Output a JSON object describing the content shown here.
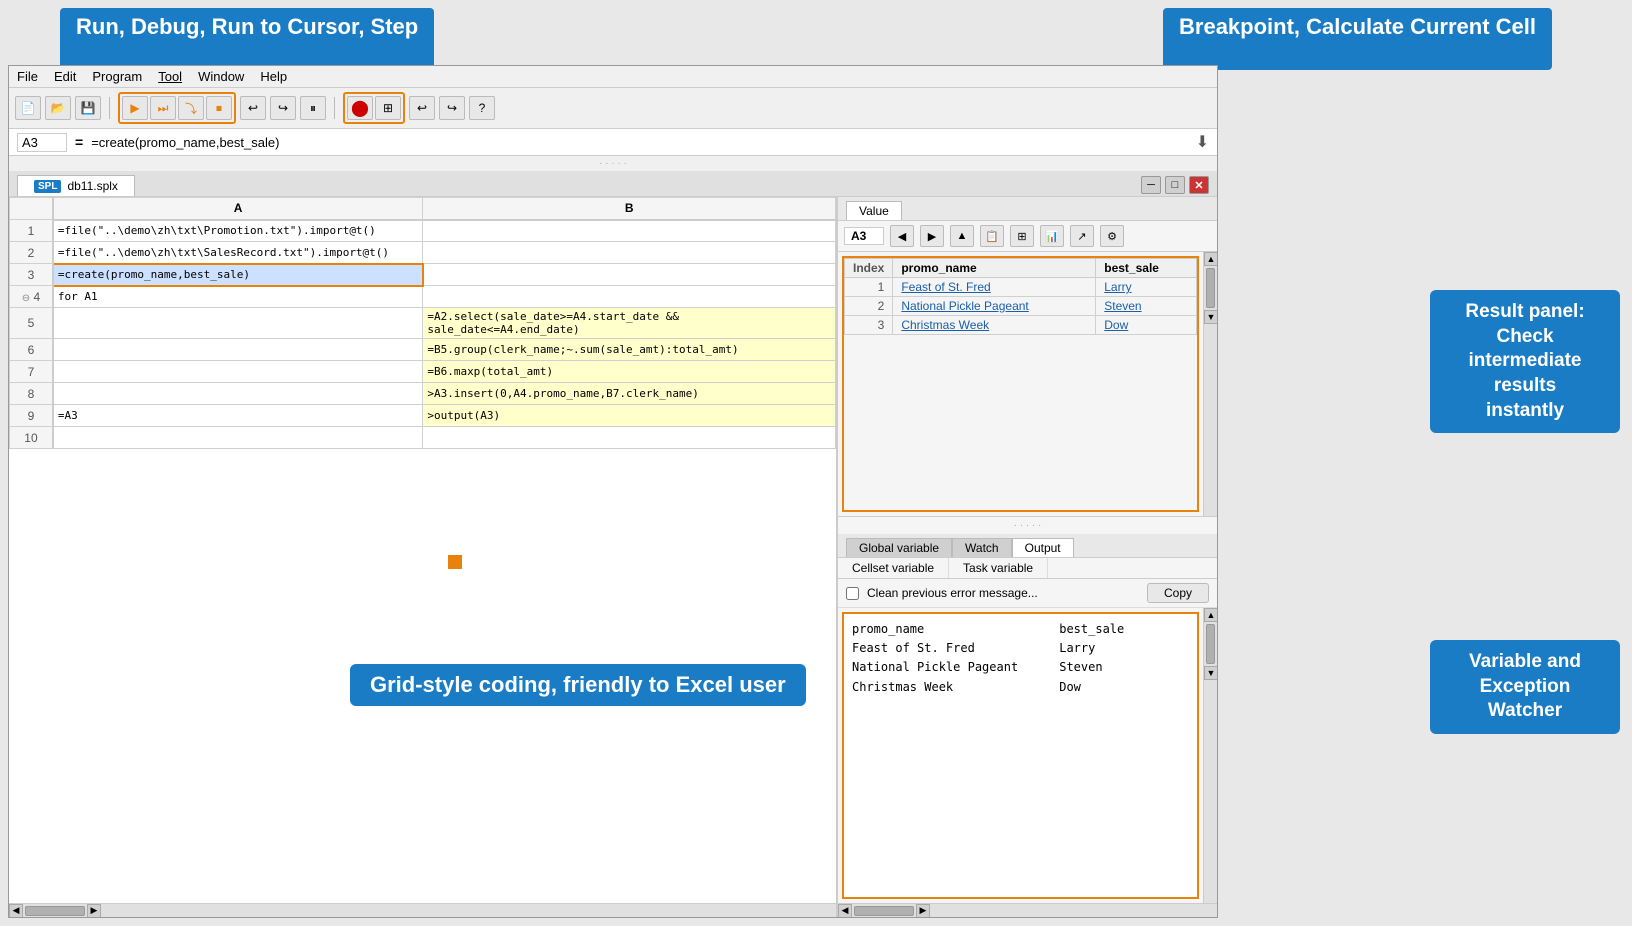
{
  "annotations": {
    "top_left": "Run, Debug, Run to Cursor, Step",
    "top_right": "Breakpoint, Calculate Current Cell",
    "right_middle": "Result panel:\nCheck\nintermediate\nresults\ninstantly",
    "right_bottom": "Variable and\nException\nWatcher",
    "bottom_center": "Grid-style coding, friendly to Excel user"
  },
  "menu": {
    "items": [
      "File",
      "Edit",
      "Program",
      "Tool",
      "Window",
      "Help"
    ]
  },
  "formula_bar": {
    "cell_ref": "A3",
    "eq": "=",
    "formula": "=create(promo_name,best_sale)"
  },
  "file_tab": {
    "name": "db11.splx",
    "badge": "SPL"
  },
  "grid": {
    "col_headers": [
      "",
      "A",
      "B"
    ],
    "rows": [
      {
        "row": "1",
        "a": "=file(\"..\\demo\\zh\\txt\\Promotion.txt\").import@t()",
        "b": "",
        "highlight_a": false,
        "highlight_b": false
      },
      {
        "row": "2",
        "a": "=file(\"..\\demo\\zh\\txt\\SalesRecord.txt\").import@t()",
        "b": "",
        "highlight_a": false,
        "highlight_b": false
      },
      {
        "row": "3",
        "a": "=create(promo_name,best_sale)",
        "b": "",
        "highlight_a": true,
        "highlight_b": false,
        "selected_a": true
      },
      {
        "row": "4",
        "a": "for A1",
        "b": "",
        "highlight_a": false,
        "highlight_b": false,
        "group": true
      },
      {
        "row": "5",
        "a": "",
        "b": "=A2.select(sale_date>=A4.start_date &&\nsale_date<=A4.end_date)",
        "highlight_a": false,
        "highlight_b": true
      },
      {
        "row": "6",
        "a": "",
        "b": "=B5.group(clerk_name;~.sum(sale_amt):total_amt)",
        "highlight_a": false,
        "highlight_b": true
      },
      {
        "row": "7",
        "a": "",
        "b": "=B6.maxp(total_amt)",
        "highlight_a": false,
        "highlight_b": true
      },
      {
        "row": "8",
        "a": "",
        "b": ">A3.insert(0,A4.promo_name,B7.clerk_name)",
        "highlight_a": false,
        "highlight_b": true
      },
      {
        "row": "9",
        "a": "=A3",
        "b": ">output(A3)",
        "highlight_a": false,
        "highlight_b": true
      },
      {
        "row": "10",
        "a": "",
        "b": "",
        "highlight_a": false,
        "highlight_b": false
      }
    ]
  },
  "value_panel": {
    "tab": "Value",
    "cell_ref": "A3",
    "result_table": {
      "headers": [
        "Index",
        "promo_name",
        "best_sale"
      ],
      "rows": [
        {
          "index": "1",
          "promo_name": "Feast of St. Fred",
          "best_sale": "Larry"
        },
        {
          "index": "2",
          "promo_name": "National Pickle Pageant",
          "best_sale": "Steven"
        },
        {
          "index": "3",
          "promo_name": "Christmas Week",
          "best_sale": "Dow"
        }
      ]
    }
  },
  "bottom_panel": {
    "tabs": [
      "Global variable",
      "Watch",
      "Output"
    ],
    "active_tab": "Output",
    "subtabs": [
      "Cellset variable",
      "Task variable"
    ],
    "checkbox_label": "Clean previous error message...",
    "copy_button": "Copy",
    "output_lines": [
      {
        "col1": "promo_name",
        "col2": "best_sale"
      },
      {
        "col1": "Feast of St. Fred",
        "col2": "Larry"
      },
      {
        "col1": "National Pickle Pageant",
        "col2": "Steven"
      },
      {
        "col1": "Christmas Week",
        "col2": "Dow"
      }
    ]
  },
  "toolbar": {
    "buttons": [
      {
        "name": "new",
        "icon": "📄"
      },
      {
        "name": "open",
        "icon": "📂"
      },
      {
        "name": "save",
        "icon": "💾"
      }
    ],
    "debug_group": [
      {
        "name": "run",
        "icon": "▶"
      },
      {
        "name": "debug-step-over",
        "icon": "⏭"
      },
      {
        "name": "step-into",
        "icon": "⤵"
      },
      {
        "name": "stop",
        "icon": "⏹"
      }
    ],
    "breakpoint_group": [
      {
        "name": "breakpoint",
        "icon": "⬤"
      },
      {
        "name": "calculate-cell",
        "icon": "⊞"
      }
    ]
  }
}
